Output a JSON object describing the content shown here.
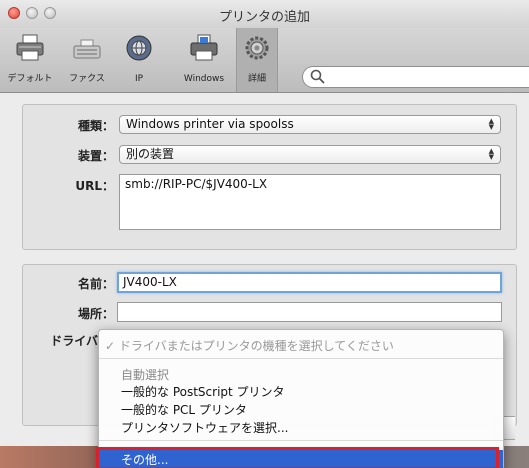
{
  "window": {
    "title": "プリンタの追加"
  },
  "toolbar": {
    "items": [
      {
        "label": "デフォルト",
        "icon": "printer-icon"
      },
      {
        "label": "ファクス",
        "icon": "fax-icon"
      },
      {
        "label": "IP",
        "icon": "globe-icon"
      },
      {
        "label": "Windows",
        "icon": "windows-printer-icon"
      },
      {
        "label": "詳細",
        "icon": "gear-icon",
        "selected": true
      }
    ],
    "search": {
      "placeholder": "",
      "label": "検索"
    }
  },
  "form": {
    "type": {
      "label": "種類：",
      "value": "Windows printer via spoolss"
    },
    "device": {
      "label": "装置：",
      "value": "別の装置"
    },
    "url": {
      "label": "URL：",
      "value": "smb://RIP-PC/$JV400-LX"
    },
    "name": {
      "label": "名前：",
      "value": "JV400-LX"
    },
    "location": {
      "label": "場所：",
      "value": ""
    },
    "driver": {
      "label": "ドライバ"
    }
  },
  "driver_menu": {
    "checked_item": "✓ ドライバまたはプリンタの機種を選択してください",
    "section_header": "自動選択",
    "items": [
      "一般的な PostScript プリンタ",
      "一般的な PCL プリンタ",
      "プリンタソフトウェアを選択..."
    ],
    "selected_item": "その他..."
  },
  "colors": {
    "highlight": "#2f63cf",
    "annotation": "#d8222a",
    "focus": "#6fa3da"
  }
}
